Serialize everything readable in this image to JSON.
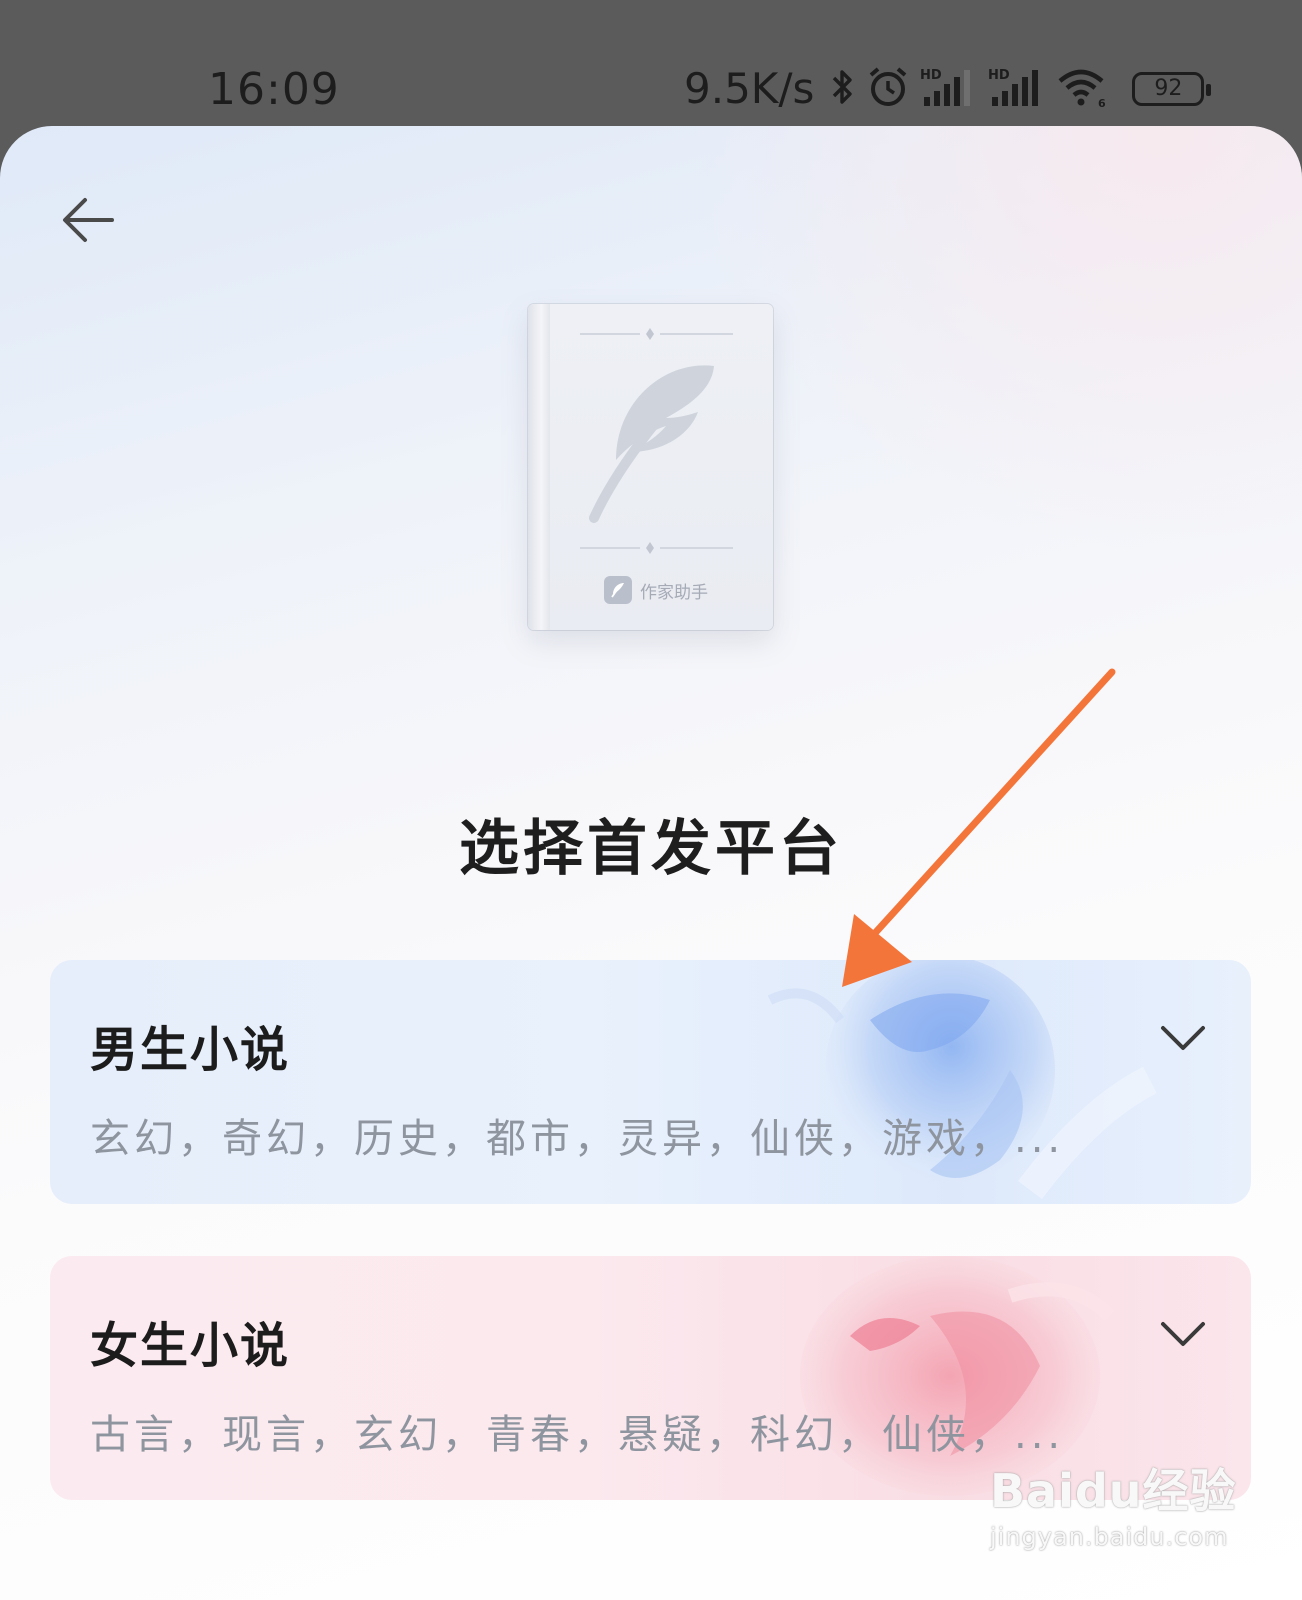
{
  "status_bar": {
    "time": "16:09",
    "net_speed": "9.5K/s",
    "battery": "92",
    "icons": [
      "bluetooth-icon",
      "alarm-icon",
      "hd-signal-icon",
      "hd-signal-icon",
      "wifi-icon",
      "battery-icon"
    ]
  },
  "header": {
    "back_icon": "arrow-left-icon"
  },
  "cover": {
    "brand_label": "作家助手",
    "icon": "feather-icon"
  },
  "page_title": "选择首发平台",
  "cards": [
    {
      "title": "男生小说",
      "tags": "玄幻，奇幻，历史，都市，灵异，仙侠，游戏，...",
      "icon": "chevron-down-icon",
      "accent": "#e6eefb"
    },
    {
      "title": "女生小说",
      "tags": "古言，现言，玄幻，青春，悬疑，科幻，仙侠，...",
      "icon": "chevron-down-icon",
      "accent": "#fbeaef"
    }
  ],
  "annotation": {
    "arrow_color": "#f4753a"
  },
  "watermark": {
    "main": "Baidu经验",
    "sub": "jingyan.baidu.com"
  }
}
